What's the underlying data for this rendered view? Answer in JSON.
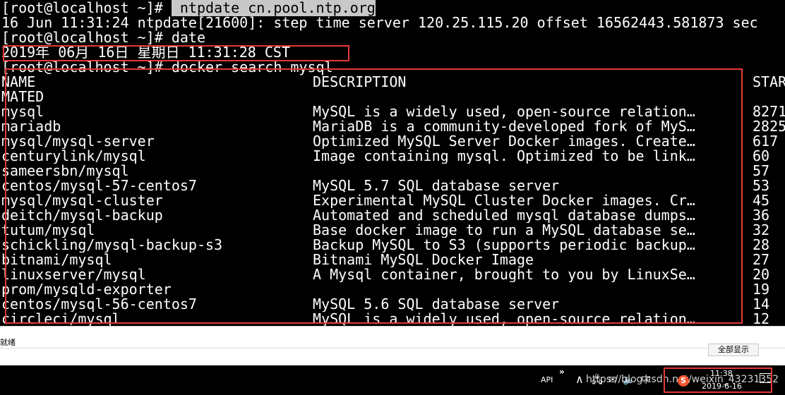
{
  "terminal": {
    "lines": {
      "l1_prompt": "[root@localhost ~]# ",
      "l1_cmd": " ntpdate cn.pool.ntp.org",
      "l2": "16 Jun 11:31:24 ntpdate[21600]: step time server 120.25.115.20 offset 16562443.581873 sec",
      "l3": "[root@localhost ~]# date",
      "l4": "2019年 06月 16日 星期日 11:31:28 CST",
      "l5": "[root@localhost ~]# docker search mysql"
    },
    "table": {
      "headers": [
        "NAME",
        "DESCRIPTION",
        "STARS"
      ],
      "header_wrap": "MATED",
      "rows": [
        [
          "mysql",
          "MySQL is a widely used, open-source relation…",
          "8271"
        ],
        [
          "mariadb",
          "MariaDB is a community-developed fork of MyS…",
          "2825"
        ],
        [
          "mysql/mysql-server",
          "Optimized MySQL Server Docker images. Create…",
          "617"
        ],
        [
          "centurylink/mysql",
          "Image containing mysql. Optimized to be link…",
          "60"
        ],
        [
          "sameersbn/mysql",
          "",
          "57"
        ],
        [
          "centos/mysql-57-centos7",
          "MySQL 5.7 SQL database server",
          "53"
        ],
        [
          "mysql/mysql-cluster",
          "Experimental MySQL Cluster Docker images. Cr…",
          "45"
        ],
        [
          "deitch/mysql-backup",
          "Automated and scheduled mysql database dumps…",
          "36"
        ],
        [
          "tutum/mysql",
          "Base docker image to run a MySQL database se…",
          "32"
        ],
        [
          "schickling/mysql-backup-s3",
          "Backup MySQL to S3 (supports periodic backup…",
          "28"
        ],
        [
          "bitnami/mysql",
          "Bitnami MySQL Docker Image",
          "27"
        ],
        [
          "linuxserver/mysql",
          "A Mysql container, brought to you by LinuxSe…",
          "20"
        ],
        [
          "prom/mysqld-exporter",
          "",
          "19"
        ],
        [
          "centos/mysql-56-centos7",
          "MySQL 5.6 SQL database server",
          "14"
        ],
        [
          "circleci/mysql",
          "MySQL is a widely used, open-source relation…",
          "12"
        ]
      ]
    }
  },
  "status_bar": {
    "text": "就绪",
    "button": "全部显示"
  },
  "taskbar": {
    "api_label": "API",
    "more": "»",
    "tray_up": "∧",
    "tray_icons": "🖧 ✉ 🔈 中",
    "watermark": "https://blog.csdn.net/weixin_43231352",
    "csdn_logo": "S",
    "clock_time": "11:38",
    "clock_date": "2019-6-16"
  },
  "colors": {
    "terminal_bg": "#000000",
    "terminal_fg": "#ffffff",
    "highlight_bg": "#c8c8c8",
    "annotation_red": "#e53935",
    "csdn_orange": "#fc5531"
  }
}
